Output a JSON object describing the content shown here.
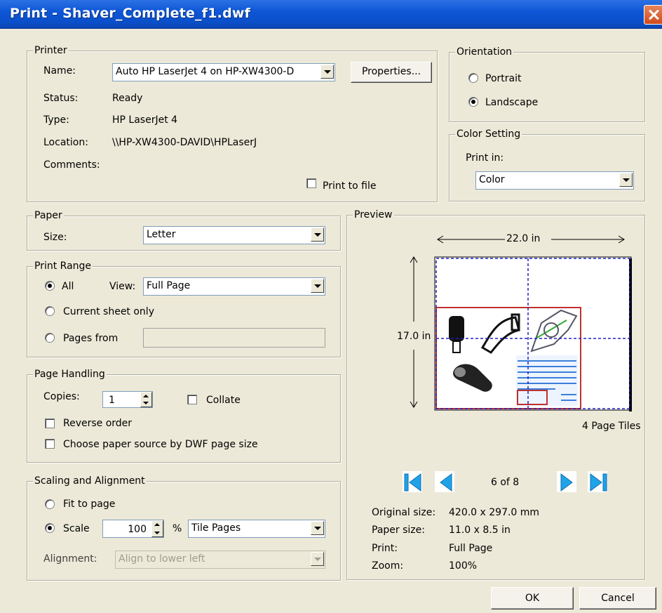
{
  "window": {
    "title": "Print - Shaver_Complete_f1.dwf"
  },
  "printer": {
    "legend": "Printer",
    "name_label": "Name:",
    "name_value": "Auto HP LaserJet 4 on HP-XW4300-D",
    "properties_label": "Properties...",
    "status_label": "Status:",
    "status_value": "Ready",
    "type_label": "Type:",
    "type_value": "HP LaserJet 4",
    "location_label": "Location:",
    "location_value": "\\\\HP-XW4300-DAVID\\HPLaserJ",
    "comments_label": "Comments:",
    "print_to_file_label": "Print to file",
    "print_to_file_checked": false
  },
  "orientation": {
    "legend": "Orientation",
    "portrait_label": "Portrait",
    "landscape_label": "Landscape",
    "selected": "Landscape"
  },
  "color_setting": {
    "legend": "Color Setting",
    "print_in_label": "Print in:",
    "value": "Color"
  },
  "paper": {
    "legend": "Paper",
    "size_label": "Size:",
    "size_value": "Letter"
  },
  "print_range": {
    "legend": "Print Range",
    "all_label": "All",
    "view_label": "View:",
    "view_value": "Full Page",
    "current_sheet_label": "Current sheet only",
    "pages_from_label": "Pages from",
    "pages_from_value": "",
    "selected": "All"
  },
  "page_handling": {
    "legend": "Page Handling",
    "copies_label": "Copies:",
    "copies_value": "1",
    "collate_label": "Collate",
    "reverse_order_label": "Reverse order",
    "choose_paper_label": "Choose paper source by DWF page size"
  },
  "scaling": {
    "legend": "Scaling and Alignment",
    "fit_label": "Fit to page",
    "scale_label": "Scale",
    "scale_value": "100",
    "percent_label": "%",
    "tile_value": "Tile Pages",
    "alignment_label": "Alignment:",
    "alignment_value": "Align to lower left",
    "selected": "Scale"
  },
  "preview": {
    "legend": "Preview",
    "width_label": "22.0 in",
    "height_label": "17.0 in",
    "tiles_label": "4 Page Tiles",
    "page_indicator": "6 of 8",
    "original_size_label": "Original size:",
    "original_size_value": "420.0 x 297.0 mm",
    "paper_size_label": "Paper size:",
    "paper_size_value": "11.0 x 8.5 in",
    "print_label": "Print:",
    "print_value": "Full Page",
    "zoom_label": "Zoom:",
    "zoom_value": "100%"
  },
  "buttons": {
    "ok": "OK",
    "cancel": "Cancel"
  },
  "colors": {
    "title_bar": "#0a4fc9",
    "nav_arrow": "#1fa3e8",
    "sheet_border": "#c03030",
    "tile_lines": "#2020c0"
  },
  "icons": [
    "close-icon",
    "first-page-icon",
    "previous-page-icon",
    "next-page-icon",
    "last-page-icon",
    "dropdown-arrow-icon"
  ]
}
